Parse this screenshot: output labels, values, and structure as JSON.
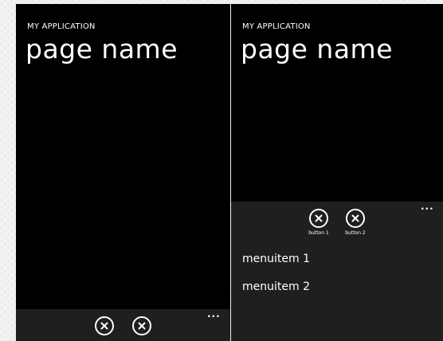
{
  "left_screen": {
    "app_title": "MY APPLICATION",
    "page_title": "page name",
    "appbar": {
      "more_glyph": "...",
      "buttons": [
        {
          "icon": "cancel-circle-icon"
        },
        {
          "icon": "cancel-circle-icon"
        }
      ]
    }
  },
  "right_screen": {
    "app_title": "MY APPLICATION",
    "page_title": "page name",
    "appbar": {
      "more_glyph": "...",
      "buttons": [
        {
          "icon": "cancel-circle-icon",
          "label": "button 1"
        },
        {
          "icon": "cancel-circle-icon",
          "label": "button 2"
        }
      ],
      "menu_items": [
        "menuitem 1",
        "menuitem 2"
      ]
    }
  },
  "colors": {
    "page_background": "#000000",
    "appbar_background": "#1f1f1f",
    "foreground": "#ffffff"
  }
}
